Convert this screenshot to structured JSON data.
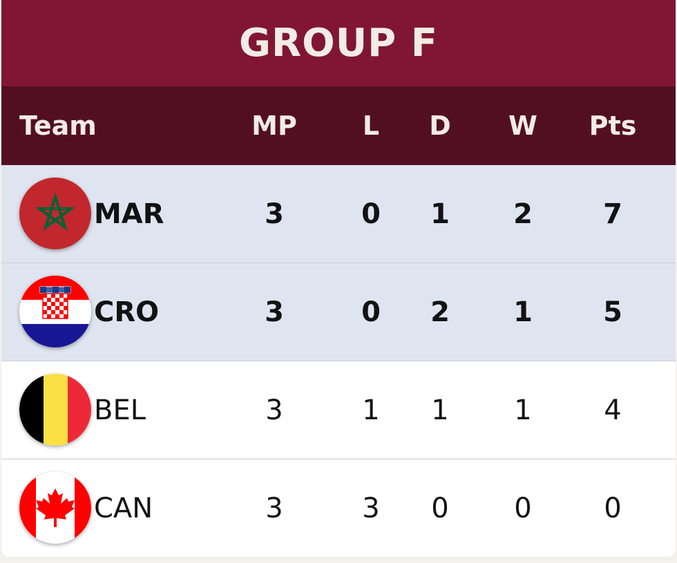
{
  "title": "GROUP F",
  "columns": {
    "team": "Team",
    "mp": "MP",
    "l": "L",
    "d": "D",
    "w": "W",
    "pts": "Pts"
  },
  "rows": [
    {
      "team": "MAR",
      "flag": "morocco-flag-icon",
      "mp": "3",
      "l": "0",
      "d": "1",
      "w": "2",
      "pts": "7",
      "qualified": true
    },
    {
      "team": "CRO",
      "flag": "croatia-flag-icon",
      "mp": "3",
      "l": "0",
      "d": "2",
      "w": "1",
      "pts": "5",
      "qualified": true
    },
    {
      "team": "BEL",
      "flag": "belgium-flag-icon",
      "mp": "3",
      "l": "1",
      "d": "1",
      "w": "1",
      "pts": "4",
      "qualified": false
    },
    {
      "team": "CAN",
      "flag": "canada-flag-icon",
      "mp": "3",
      "l": "3",
      "d": "0",
      "w": "0",
      "pts": "0",
      "qualified": false
    }
  ],
  "colors": {
    "title_bar": "#801634",
    "header_bar": "#530f22",
    "qualified_row": "#dfe5f0",
    "text_light": "#f3ece4"
  }
}
